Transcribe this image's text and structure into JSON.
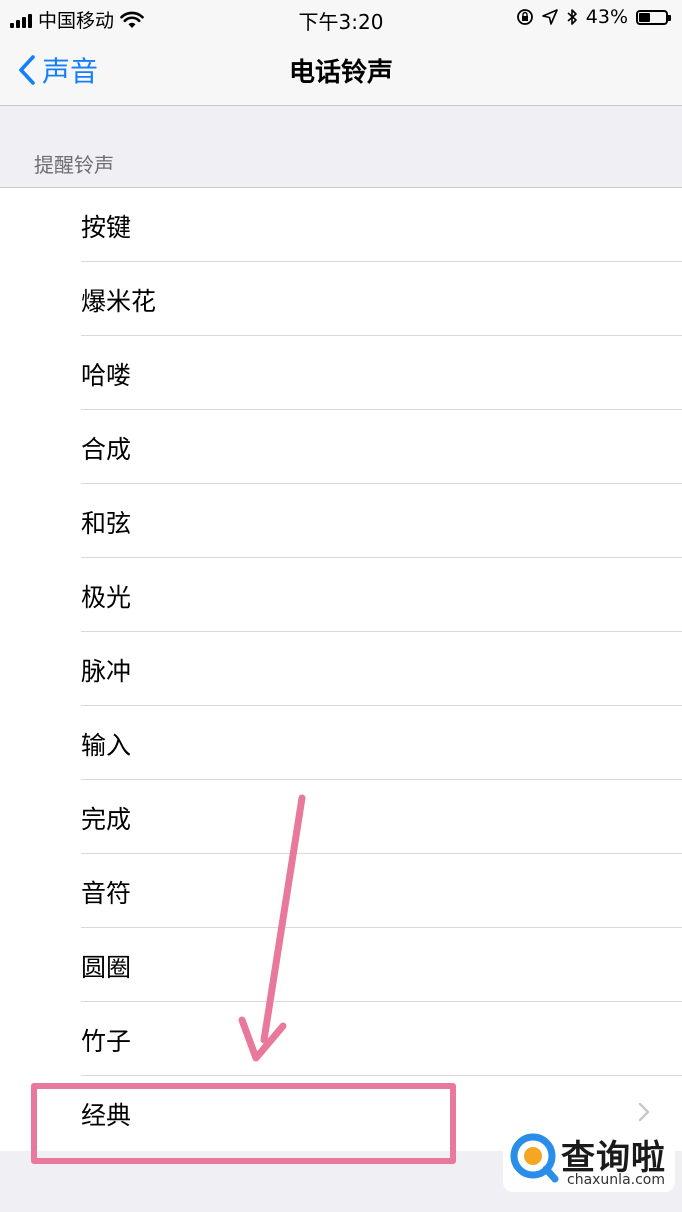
{
  "status_bar": {
    "carrier": "中国移动",
    "time": "下午3:20",
    "battery_text": "43%",
    "battery_level": 0.43
  },
  "nav": {
    "back_label": "声音",
    "title": "电话铃声"
  },
  "section": {
    "header": "提醒铃声"
  },
  "tones": [
    {
      "label": "按键"
    },
    {
      "label": "爆米花"
    },
    {
      "label": "哈喽"
    },
    {
      "label": "合成"
    },
    {
      "label": "和弦"
    },
    {
      "label": "极光"
    },
    {
      "label": "脉冲"
    },
    {
      "label": "输入"
    },
    {
      "label": "完成"
    },
    {
      "label": "音符"
    },
    {
      "label": "圆圈"
    },
    {
      "label": "竹子"
    },
    {
      "label": "经典"
    }
  ],
  "watermark": {
    "title": "查询啦",
    "subtitle": "chaxunla.com"
  },
  "colors": {
    "accent": "#157efb",
    "highlight": "#e8799c",
    "logo_blue": "#2a8ee8",
    "logo_orange": "#f5a623"
  },
  "icons": {
    "back": "chevron-left-icon",
    "disclosure": "chevron-right-icon",
    "wifi": "wifi-icon",
    "orientation_lock": "orientation-lock-icon",
    "location": "location-arrow-icon",
    "bluetooth": "bluetooth-icon",
    "battery": "battery-icon",
    "signal": "cellular-signal-icon"
  }
}
